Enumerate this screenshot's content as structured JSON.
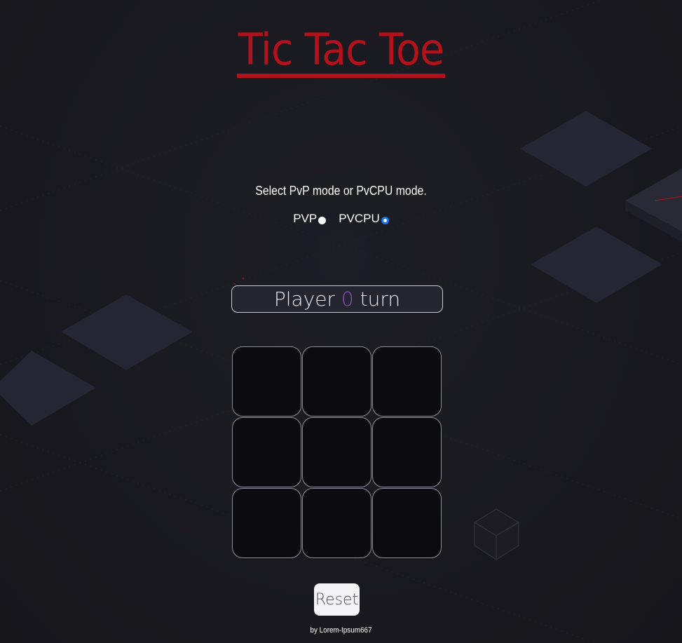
{
  "page": {
    "title": "Tic Tac Toe",
    "mode_prompt": "Select PvP mode or PvCPU mode.",
    "modes": [
      {
        "label": "PVP",
        "selected": false
      },
      {
        "label": "PVCPU",
        "selected": true
      }
    ],
    "turn": {
      "prefix": "Player",
      "mark": "0",
      "suffix": "turn"
    },
    "board": {
      "cells": [
        "",
        "",
        "",
        "",
        "",
        "",
        "",
        "",
        ""
      ]
    },
    "reset_label": "Reset",
    "credit": "by Lorem-Ipsum667"
  },
  "colors": {
    "background": "#1a1a20",
    "title": "#b3121c",
    "player_mark": "#8a4fb8",
    "cell": "#0c0c10",
    "radio_accent": "#1a73e8"
  }
}
